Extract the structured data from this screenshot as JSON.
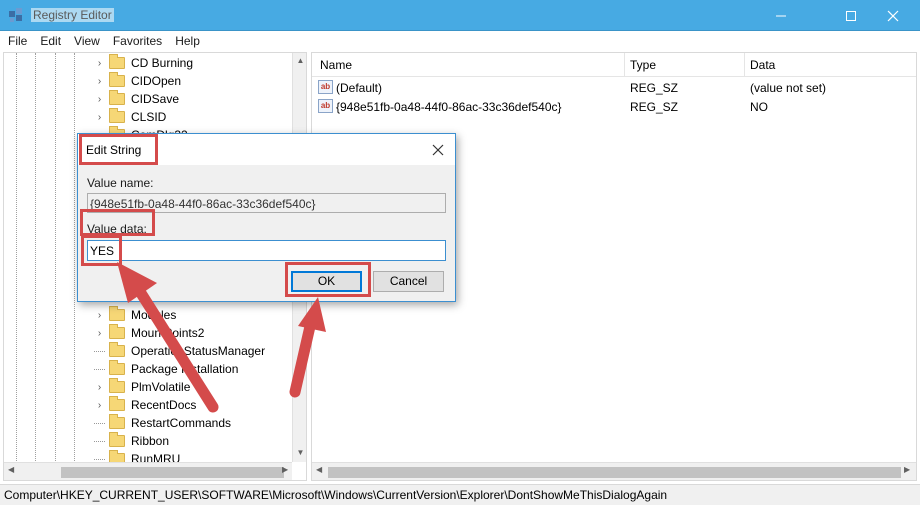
{
  "window": {
    "title": "Registry Editor",
    "controls": [
      "minimize",
      "maximize",
      "close"
    ]
  },
  "menu": [
    "File",
    "Edit",
    "View",
    "Favorites",
    "Help"
  ],
  "tree": {
    "items": [
      {
        "label": "CD Burning",
        "expandable": true
      },
      {
        "label": "CIDOpen",
        "expandable": true
      },
      {
        "label": "CIDSave",
        "expandable": true
      },
      {
        "label": "CLSID",
        "expandable": true
      },
      {
        "label": "ComDlg32",
        "expandable": true
      },
      {
        "label": "Modules",
        "expandable": true
      },
      {
        "label": "MountPoints2",
        "expandable": true
      },
      {
        "label": "OperationStatusManager",
        "expandable": false
      },
      {
        "label": "Package Installation",
        "expandable": false
      },
      {
        "label": "PlmVolatile",
        "expandable": true
      },
      {
        "label": "RecentDocs",
        "expandable": true
      },
      {
        "label": "RestartCommands",
        "expandable": false
      },
      {
        "label": "Ribbon",
        "expandable": false
      },
      {
        "label": "RunMRU",
        "expandable": false
      }
    ]
  },
  "list": {
    "columns": {
      "name": "Name",
      "type": "Type",
      "data": "Data"
    },
    "rows": [
      {
        "icon": "string-value-icon",
        "name": "(Default)",
        "type": "REG_SZ",
        "data": "(value not set)"
      },
      {
        "icon": "string-value-icon",
        "name": "{948e51fb-0a48-44f0-86ac-33c36def540c}",
        "type": "REG_SZ",
        "data": "NO"
      }
    ]
  },
  "dialog": {
    "title": "Edit String",
    "value_name_label": "Value name:",
    "value_name": "{948e51fb-0a48-44f0-86ac-33c36def540c}",
    "value_data_label": "Value data:",
    "value_data": "YES",
    "ok_label": "OK",
    "cancel_label": "Cancel"
  },
  "status": {
    "path": "Computer\\HKEY_CURRENT_USER\\SOFTWARE\\Microsoft\\Windows\\CurrentVersion\\Explorer\\DontShowMeThisDialogAgain"
  },
  "colors": {
    "titlebar": "#47aae3",
    "highlight": "#d44b4b",
    "accent": "#0078d7"
  }
}
